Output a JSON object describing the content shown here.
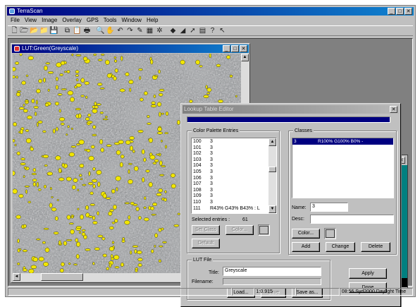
{
  "app": {
    "title": "TerraScan"
  },
  "menu": [
    "File",
    "View",
    "Image",
    "Overlay",
    "GPS",
    "Tools",
    "Window",
    "Help"
  ],
  "toolbar": [
    "new-file-icon",
    "open-file-icon",
    "open-project-icon",
    "open-folder-icon",
    "save-icon",
    "copy-icon",
    "paste-icon",
    "print-icon",
    "zoom-icon",
    "hand-pan-icon",
    "undo-icon",
    "redo-icon",
    "pencil-icon",
    "select-icon",
    "settings-icon",
    "cube-icon",
    "measure-icon",
    "pointer-icon",
    "layers-icon",
    "info-icon",
    "context-help-icon"
  ],
  "window_controls": {
    "minimize": "_",
    "maximize": "□",
    "close": "✕"
  },
  "image_window": {
    "title": "LUT:Green(Greyscale)",
    "scroll_up": "▲",
    "scroll_down": "▼",
    "scroll_left": "◄",
    "scroll_right": "►"
  },
  "dialog": {
    "title": "Lookup Table Editor",
    "close": "✕",
    "progress_fraction": 1.0,
    "palette": {
      "label": "Color Palette Entries",
      "entries": [
        {
          "index": "100",
          "value": "3"
        },
        {
          "index": "101",
          "value": "3"
        },
        {
          "index": "102",
          "value": "3"
        },
        {
          "index": "103",
          "value": "3"
        },
        {
          "index": "104",
          "value": "3"
        },
        {
          "index": "105",
          "value": "3"
        },
        {
          "index": "106",
          "value": "3"
        },
        {
          "index": "107",
          "value": "3"
        },
        {
          "index": "108",
          "value": "3"
        },
        {
          "index": "109",
          "value": "3"
        },
        {
          "index": "110",
          "value": "3"
        },
        {
          "index": "111",
          "value": "R43% G43% B43% : L"
        }
      ],
      "selected_label": "Selected entries :",
      "selected_count": "61",
      "set_class_button": "Set Class",
      "color_button": "Color...",
      "default_button": "Default",
      "scroll_up": "▲",
      "scroll_down": "▼"
    },
    "classes": {
      "label": "Classes",
      "items": [
        {
          "id": "3",
          "color": "R100% G100% B0% -"
        }
      ],
      "name_label": "Name:",
      "name_value": "3",
      "desc_label": "Desc:",
      "desc_value": "",
      "color_button": "Color...",
      "add_button": "Add",
      "change_button": "Change",
      "delete_button": "Delete"
    },
    "lut_file": {
      "label": "LUT File",
      "title_label": "Title:",
      "title_value": "Greyscale",
      "filename_label": "Filename:",
      "filename_value": "",
      "load_button": "Load...",
      "save_button": "Save",
      "save_as_button": "Save as..."
    },
    "apply_button": "Apply",
    "done_button": "Done"
  },
  "background_window": {
    "close": "✕"
  },
  "status": {
    "scale": "1:0.915",
    "time": "08:56 Syd2000 Daylight Time"
  },
  "colors": {
    "titlebar": "#000080",
    "overlay": "#f2e600",
    "face": "#c0c0c0",
    "teal": "#008080"
  }
}
